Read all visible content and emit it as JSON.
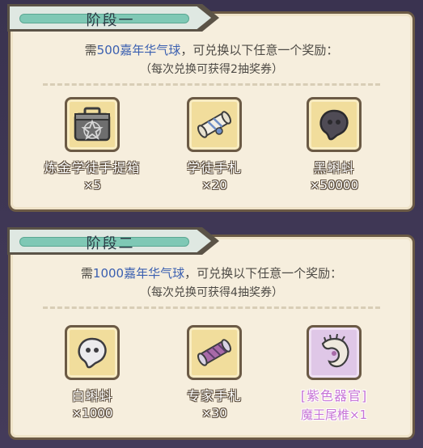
{
  "stage1": {
    "title": "阶段一",
    "req_prefix": "需",
    "req_amount": "500嘉年华气球",
    "req_suffix": "，可兑换以下任意一个奖励：",
    "sub": "（每次兑换可获得2抽奖券）",
    "items": [
      {
        "name": "炼金学徒手提箱",
        "qty": "×5",
        "icon": "briefcase-icon"
      },
      {
        "name": "学徒手札",
        "qty": "×20",
        "icon": "scroll-icon"
      },
      {
        "name": "黑蝌蚪",
        "qty": "×50000",
        "icon": "black-tadpole-icon"
      }
    ]
  },
  "stage2": {
    "title": "阶段二",
    "req_prefix": "需",
    "req_amount": "1000嘉年华气球",
    "req_suffix": "，可兑换以下任意一个奖励：",
    "sub": "（每次兑换可获得4抽奖券）",
    "items": [
      {
        "name": "白蝌蚪",
        "qty": "×1000",
        "icon": "white-tadpole-icon"
      },
      {
        "name": "专家手札",
        "qty": "×30",
        "icon": "expert-scroll-icon"
      },
      {
        "name": "[紫色器官]",
        "qty": "魔王尾椎×1",
        "icon": "demon-tail-icon"
      }
    ]
  },
  "colors": {
    "highlight": "#3a5fb0",
    "panel_bg": "#f6eedd",
    "border": "#6b5a45",
    "gold_tile": "#f1dd9c",
    "purple_tile": "#dfc7e7",
    "purple_text": "#c775d6"
  }
}
